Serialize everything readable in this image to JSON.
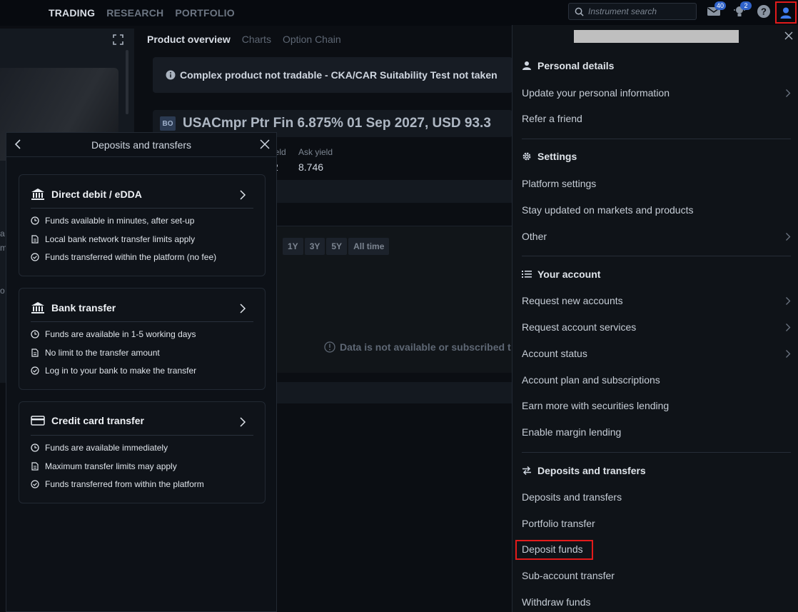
{
  "topbar": {
    "nav": [
      "TRADING",
      "RESEARCH",
      "PORTFOLIO"
    ],
    "search_placeholder": "Instrument search",
    "messages_count": "40",
    "notifications_count": "2"
  },
  "center": {
    "tabs": [
      "Product overview",
      "Charts",
      "Option Chain"
    ],
    "warning": "Complex product not tradable - CKA/CAR Suitability Test not taken",
    "product_badge": "BO",
    "product_name": "USACmpr Ptr Fin 6.875% 01 Sep 2027, USD  93.3",
    "bid_yield_label": "ield",
    "bid_yield_value": "2",
    "ask_yield_label": "Ask yield",
    "ask_yield_value": "8.746",
    "ranges": [
      "1Y",
      "3Y",
      "5Y",
      "All time"
    ],
    "no_data": "Data is not available or subscribed t",
    "left_edge_chars": [
      "a",
      "m",
      "o"
    ]
  },
  "deposits": {
    "title": "Deposits and transfers",
    "cards": [
      {
        "title": "Direct debit / eDDA",
        "rows": [
          "Funds available in minutes, after set-up",
          "Local bank network transfer limits apply",
          "Funds transferred within the platform (no fee)"
        ]
      },
      {
        "title": "Bank transfer",
        "rows": [
          "Funds are available in 1-5 working days",
          "No limit to the transfer amount",
          "Log in to your bank to make the transfer"
        ]
      },
      {
        "title": "Credit card transfer",
        "rows": [
          "Funds are available immediately",
          "Maximum transfer limits may apply",
          "Funds transferred from within the platform"
        ]
      }
    ]
  },
  "menu": {
    "personal": {
      "title": "Personal details",
      "items": [
        "Update your personal information",
        "Refer a friend"
      ]
    },
    "settings": {
      "title": "Settings",
      "items": [
        "Platform settings",
        "Stay updated on markets and products",
        "Other"
      ]
    },
    "account": {
      "title": "Your account",
      "items": [
        "Request new accounts",
        "Request account services",
        "Account status",
        "Account plan and subscriptions",
        "Earn more with securities lending",
        "Enable margin lending"
      ]
    },
    "deposits": {
      "title": "Deposits and transfers",
      "items": [
        "Deposits and transfers",
        "Portfolio transfer",
        "Deposit funds",
        "Sub-account transfer",
        "Withdraw funds"
      ]
    }
  },
  "colors": {
    "highlight": "#e21b1b",
    "accent_badge": "#2f62c9"
  }
}
